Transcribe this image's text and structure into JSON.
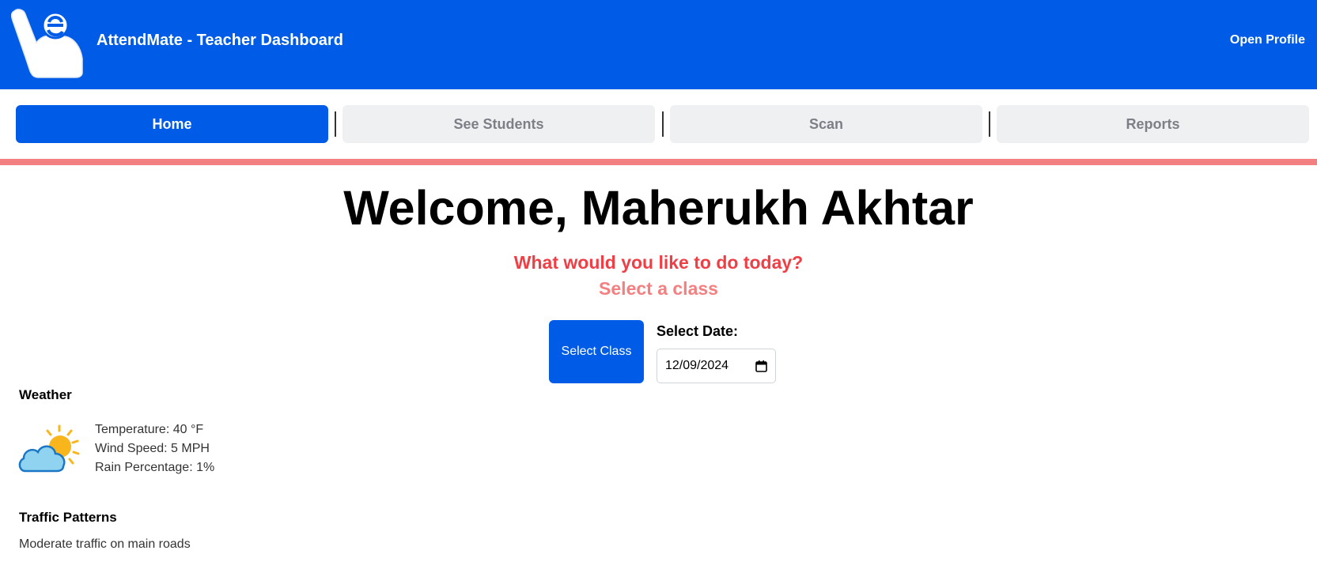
{
  "header": {
    "app_title": "AttendMate - Teacher Dashboard",
    "profile_label": "Open Profile",
    "brand_color": "#005ce6",
    "logo_icon": "hand-logo-icon"
  },
  "tabs": [
    {
      "label": "Home",
      "active": true
    },
    {
      "label": "See Students",
      "active": false
    },
    {
      "label": "Scan",
      "active": false
    },
    {
      "label": "Reports",
      "active": false
    }
  ],
  "main": {
    "welcome": "Welcome, Maherukh Akhtar",
    "question": "What would you like to do today?",
    "select_class_prompt": "Select a class",
    "select_class_button": "Select Class",
    "date_label": "Select Date:",
    "date_value": "12/09/2024"
  },
  "weather": {
    "title": "Weather",
    "icon": "partly-cloudy-icon",
    "temperature": "Temperature: 40 °F",
    "wind": "Wind Speed: 5 MPH",
    "rain": "Rain Percentage: 1%"
  },
  "traffic": {
    "title": "Traffic Patterns",
    "description": "Moderate traffic on main roads"
  },
  "colors": {
    "accent": "#005ce6",
    "question_red": "#ef3e44",
    "pink": "#f47f80"
  }
}
